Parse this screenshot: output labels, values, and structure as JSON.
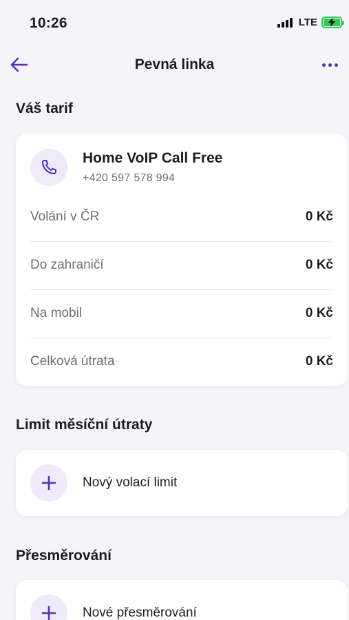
{
  "status_bar": {
    "time": "10:26",
    "network": "LTE",
    "battery_color": "#34c759"
  },
  "nav": {
    "title": "Pevná linka",
    "accent": "#5b2fb5"
  },
  "tariff_section": {
    "title": "Váš tarif",
    "plan_name": "Home VoIP Call Free",
    "phone_number": "+420 597 578 994",
    "icon": "phone-icon",
    "rows": [
      {
        "label": "Volání v ČR",
        "value": "0 Kč"
      },
      {
        "label": "Do zahraničí",
        "value": "0 Kč"
      },
      {
        "label": "Na mobil",
        "value": "0 Kč"
      },
      {
        "label": "Celková útrata",
        "value": "0 Kč"
      }
    ]
  },
  "limit_section": {
    "title": "Limit měsíční útraty",
    "action_label": "Nový volací limit",
    "icon": "plus-icon"
  },
  "redirect_section": {
    "title": "Přesměrování",
    "action_label": "Nové přesměrování",
    "icon": "plus-icon"
  }
}
